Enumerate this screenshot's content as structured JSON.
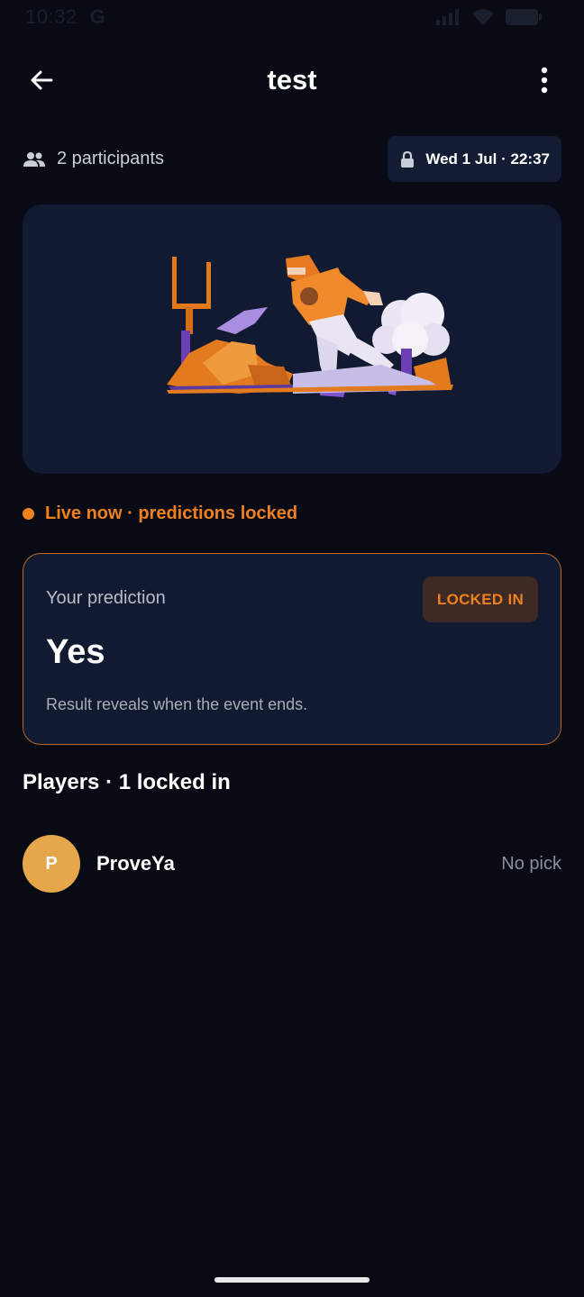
{
  "status_bar": {
    "time": "10:32",
    "carrier_glyph": "G",
    "icons": [
      "signal-icon",
      "wifi-icon",
      "battery-icon"
    ]
  },
  "app_bar": {
    "title": "test",
    "back_icon": "arrow-left-icon",
    "menu_icon": "more-vert-icon"
  },
  "event": {
    "participants_label": "2 participants",
    "lock_time": "Wed 1 Jul · 22:37",
    "live_status": "Live now · predictions locked"
  },
  "prediction": {
    "label": "Your prediction",
    "badge": "LOCKED IN",
    "value": "Yes",
    "note": "Result reveals when the event ends."
  },
  "players": {
    "heading": "Players · 1 locked in",
    "list": [
      {
        "initial": "P",
        "name": "ProveYa",
        "pick": "No pick"
      }
    ]
  },
  "colors": {
    "background": "#080b14",
    "card": "#121a32",
    "accent": "#f0801e",
    "avatar": "#e6a64a"
  }
}
